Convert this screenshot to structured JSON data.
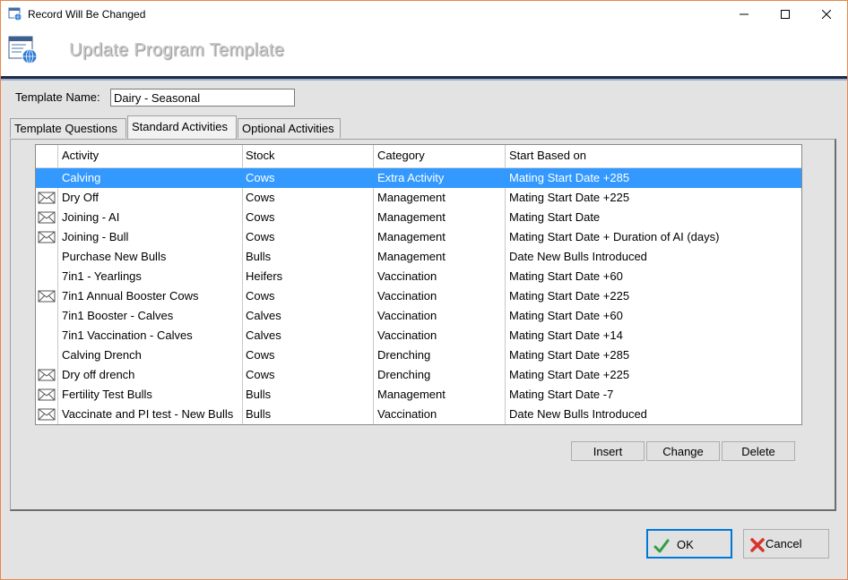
{
  "window": {
    "title": "Record Will Be Changed"
  },
  "header": {
    "heading": "Update Program Template"
  },
  "form": {
    "template_name_label": "Template Name:",
    "template_name_value": "Dairy - Seasonal"
  },
  "tabs": [
    {
      "label": "Template Questions"
    },
    {
      "label": "Standard Activities"
    },
    {
      "label": "Optional Activities"
    }
  ],
  "grid": {
    "columns": [
      "Activity",
      "Stock",
      "Category",
      "Start Based on"
    ],
    "rows": [
      {
        "icon": "",
        "activity": "Calving",
        "stock": "Cows",
        "category": "Extra Activity",
        "start": "Mating Start Date +285"
      },
      {
        "icon": "envelope-icon",
        "activity": "Dry Off",
        "stock": "Cows",
        "category": "Management",
        "start": "Mating Start Date +225"
      },
      {
        "icon": "envelope-icon",
        "activity": "Joining - AI",
        "stock": "Cows",
        "category": "Management",
        "start": "Mating Start Date"
      },
      {
        "icon": "envelope-icon",
        "activity": "Joining - Bull",
        "stock": "Cows",
        "category": "Management",
        "start": "Mating Start Date + Duration of AI (days)"
      },
      {
        "icon": "",
        "activity": "Purchase New Bulls",
        "stock": "Bulls",
        "category": "Management",
        "start": "Date New Bulls Introduced"
      },
      {
        "icon": "",
        "activity": "7in1 - Yearlings",
        "stock": "Heifers",
        "category": "Vaccination",
        "start": "Mating Start Date +60"
      },
      {
        "icon": "envelope-icon",
        "activity": "7in1 Annual Booster Cows",
        "stock": "Cows",
        "category": "Vaccination",
        "start": "Mating Start Date +225"
      },
      {
        "icon": "",
        "activity": "7in1 Booster - Calves",
        "stock": "Calves",
        "category": "Vaccination",
        "start": "Mating Start Date +60"
      },
      {
        "icon": "",
        "activity": "7in1 Vaccination - Calves",
        "stock": "Calves",
        "category": "Vaccination",
        "start": "Mating Start Date +14"
      },
      {
        "icon": "",
        "activity": "Calving Drench",
        "stock": "Cows",
        "category": "Drenching",
        "start": "Mating Start Date +285"
      },
      {
        "icon": "envelope-icon",
        "activity": "Dry off drench",
        "stock": "Cows",
        "category": "Drenching",
        "start": "Mating Start Date +225"
      },
      {
        "icon": "envelope-icon",
        "activity": "Fertility Test  Bulls",
        "stock": "Bulls",
        "category": "Management",
        "start": "Mating Start Date -7"
      },
      {
        "icon": "envelope-icon",
        "activity": "Vaccinate and PI test  - New Bulls",
        "stock": "Bulls",
        "category": "Vaccination",
        "start": "Date New Bulls Introduced"
      }
    ]
  },
  "buttons": {
    "insert": "Insert",
    "change": "Change",
    "delete": "Delete",
    "ok": "OK",
    "cancel": "Cancel"
  },
  "colors": {
    "selection": "#3399ff",
    "ok_border": "#0078d7",
    "window_border": "#e8874a",
    "ok_check": "#2f9e44",
    "cancel_x": "#d9342b"
  }
}
